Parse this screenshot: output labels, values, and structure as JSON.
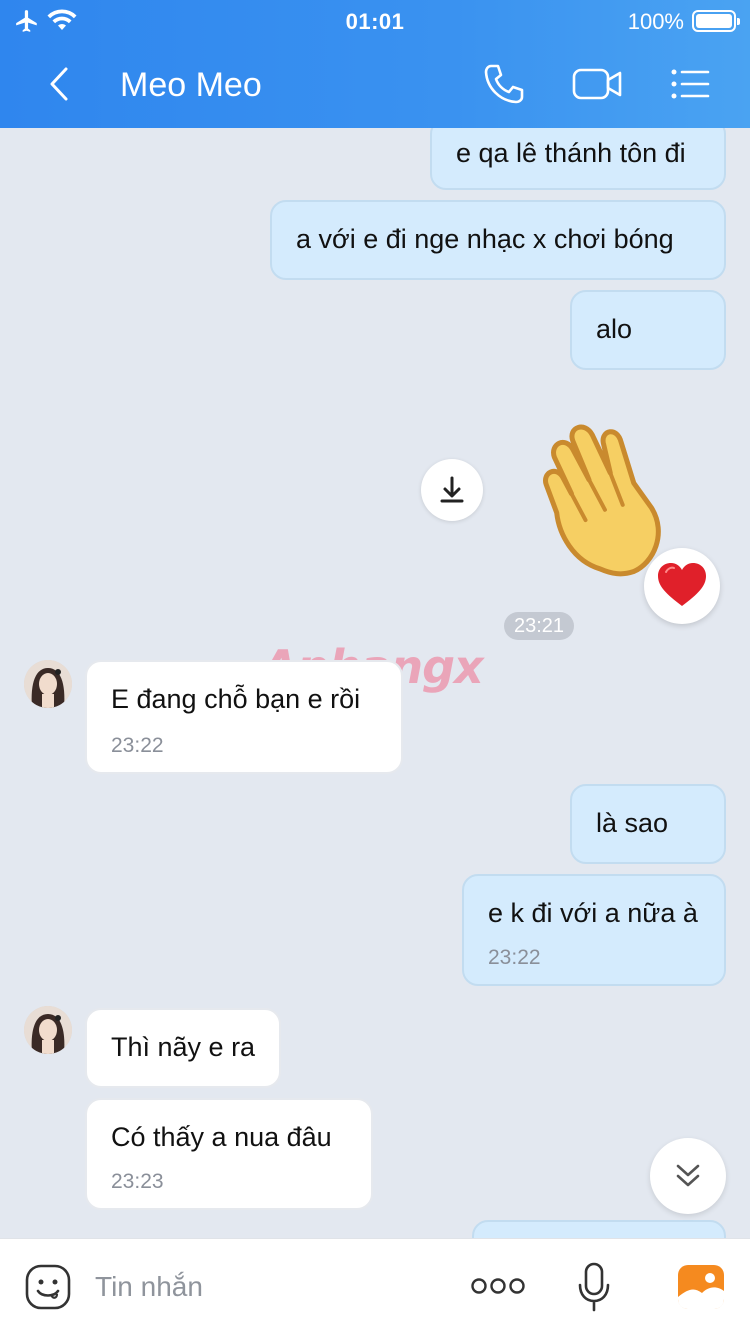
{
  "status": {
    "time": "01:01",
    "battery": "100%"
  },
  "header": {
    "title": "Meo Meo"
  },
  "messages": {
    "m1": "e qa lê thánh tôn đi",
    "m2": "a với e đi nge nhạc x chơi bóng",
    "m3": "alo",
    "divider_time": "23:21",
    "m4": "E đang chỗ bạn e rồi",
    "m4_time": "23:22",
    "m5": "là sao",
    "m6": "e k đi với a nữa à",
    "m6_time": "23:22",
    "m7": "Thì nãy e ra",
    "m8": "Có thấy a nua đâu",
    "m8_time": "23:23"
  },
  "watermark": "Aphangx",
  "input": {
    "placeholder": "Tin nhắn"
  },
  "colors": {
    "header": "#2f86ee",
    "outgoing": "#d4ebfd",
    "incoming": "#ffffff",
    "background": "#e3e8f0"
  }
}
